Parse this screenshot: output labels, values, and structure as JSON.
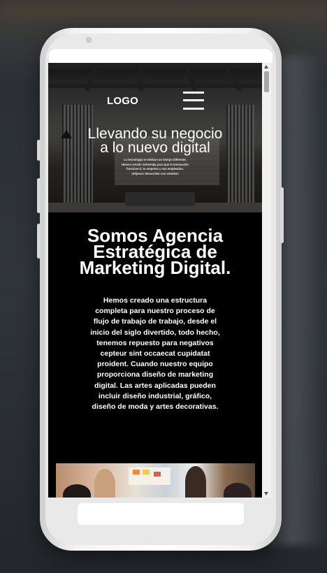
{
  "header": {
    "logo": "LOGO",
    "menu_icon": "hamburger-menu-icon"
  },
  "hero": {
    "title_line1": "Llevando su negocio",
    "title_line2": "a lo nuevo digital",
    "text": "La tecnología se deduce un tiempo diferente. Hemos creado Schemaly para que la innovación funcione ti, tu empresa y sus empleados. ¡Déjenos desarrollar con ustedes!"
  },
  "about": {
    "title_line1": "Somos Agencia",
    "title_line2": "Estratégica de",
    "title_line3": "Marketing Digital.",
    "body": "Hemos creado una estructura completa para nuestro proceso de flujo de trabajo de trabajo, desde el inicio del siglo divertido, todo hecho, tenemos repuesto para negativos cepteur sint occaecat cupidatat proident. Cuando nuestro equipo proporciona diseño de marketing digital. Las artes aplicadas pueden incluir diseño industrial, gráfico, diseño de moda y artes decorativas."
  },
  "scrollbar": {
    "up_icon": "scroll-up-arrow-icon",
    "down_icon": "scroll-down-arrow-icon"
  },
  "colors": {
    "screen_background": "#000000",
    "text": "#ffffff",
    "phone_body": "#f4f4f4"
  }
}
